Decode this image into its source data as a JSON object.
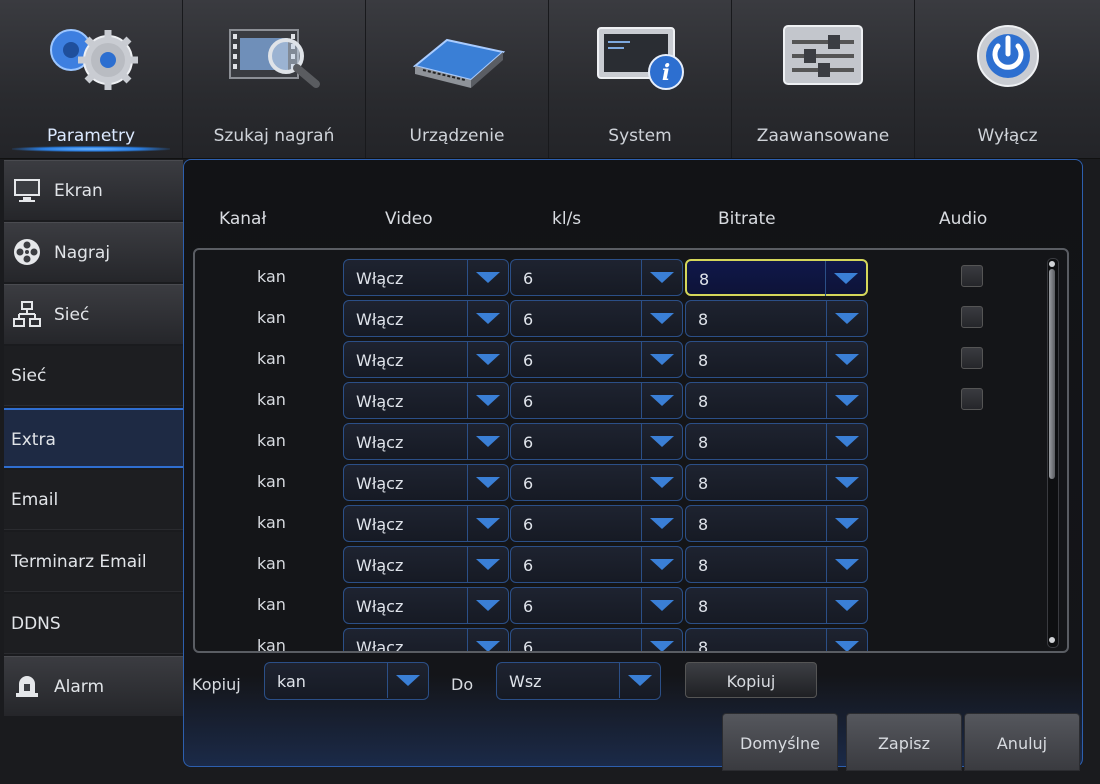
{
  "tabs": [
    {
      "label": "Parametry",
      "icon": "gears-icon",
      "active": true
    },
    {
      "label": "Szukaj nagrań",
      "icon": "film-search-icon",
      "active": false
    },
    {
      "label": "Urządzenie",
      "icon": "hard-drive-icon",
      "active": false
    },
    {
      "label": "System",
      "icon": "monitor-info-icon",
      "active": false
    },
    {
      "label": "Zaawansowane",
      "icon": "sliders-icon",
      "active": false
    },
    {
      "label": "Wyłącz",
      "icon": "power-icon",
      "active": false
    }
  ],
  "sidebar": {
    "items": [
      {
        "label": "Ekran",
        "icon": "monitor-icon"
      },
      {
        "label": "Nagraj",
        "icon": "film-reel-icon"
      },
      {
        "label": "Sieć",
        "icon": "network-icon"
      },
      {
        "label": "Sieć"
      },
      {
        "label": "Extra"
      },
      {
        "label": "Email"
      },
      {
        "label": "Terminarz Email"
      },
      {
        "label": "DDNS"
      },
      {
        "label": "Alarm",
        "icon": "alarm-icon"
      }
    ]
  },
  "table": {
    "headers": {
      "channel": "Kanał",
      "video": "Video",
      "fps": "kl/s",
      "bitrate": "Bitrate",
      "audio": "Audio"
    },
    "rows": [
      {
        "channel": "kan",
        "video": "Włącz",
        "fps": "6",
        "bitrate": "8",
        "audio": false
      },
      {
        "channel": "kan",
        "video": "Włącz",
        "fps": "6",
        "bitrate": "8",
        "audio": false
      },
      {
        "channel": "kan",
        "video": "Włącz",
        "fps": "6",
        "bitrate": "8",
        "audio": false
      },
      {
        "channel": "kan",
        "video": "Włącz",
        "fps": "6",
        "bitrate": "8",
        "audio": false
      },
      {
        "channel": "kan",
        "video": "Włącz",
        "fps": "6",
        "bitrate": "8"
      },
      {
        "channel": "kan",
        "video": "Włącz",
        "fps": "6",
        "bitrate": "8"
      },
      {
        "channel": "kan",
        "video": "Włącz",
        "fps": "6",
        "bitrate": "8"
      },
      {
        "channel": "kan",
        "video": "Włącz",
        "fps": "6",
        "bitrate": "8"
      },
      {
        "channel": "kan",
        "video": "Włącz",
        "fps": "6",
        "bitrate": "8"
      },
      {
        "channel": "kan",
        "video": "Włącz",
        "fps": "6",
        "bitrate": "8"
      }
    ]
  },
  "copy": {
    "label": "Kopiuj",
    "from_value": "kan",
    "to_label": "Do",
    "to_value": "Wsz",
    "button": "Kopiuj"
  },
  "footer": {
    "default_button": "Domyślne",
    "save_button": "Zapisz",
    "cancel_button": "Anuluj"
  },
  "colors": {
    "accent": "#2f6ed0",
    "focus": "#d4d65a",
    "arrow": "#3a7fd6"
  }
}
